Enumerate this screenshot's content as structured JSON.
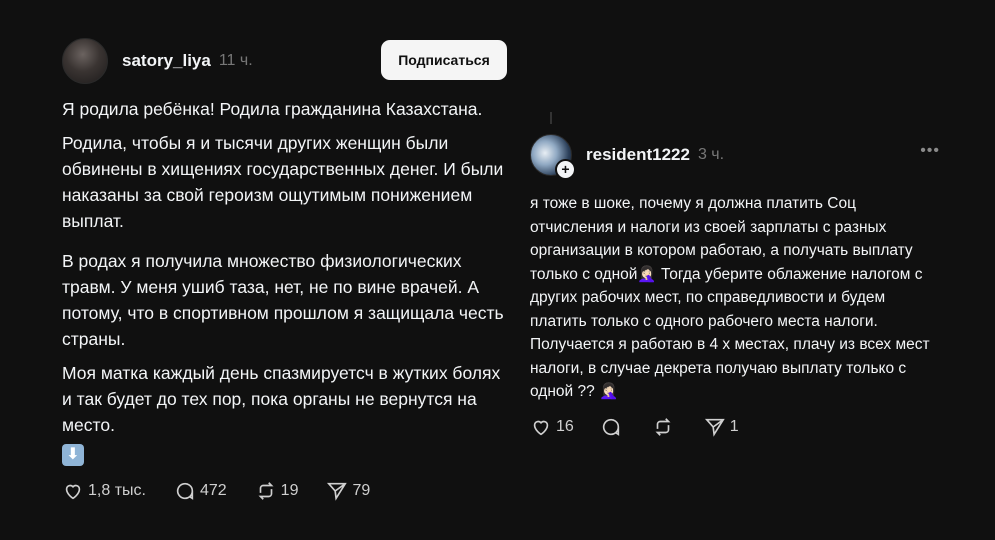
{
  "left_post": {
    "username": "satory_liya",
    "time": "11 ч.",
    "follow_label": "Подписаться",
    "paragraphs": [
      "Я родила ребёнка! Родила гражданина Казахстана.",
      "Родила, чтобы я и тысячи других женщин были обвинены в хищениях государственных денег. И были наказаны за свой героизм ощутимым понижением выплат.",
      "В родах я получила множество физиологических травм. У меня ушиб таза, нет, не по вине врачей. А потому, что в спортивном прошлом я защищала честь страны.",
      "Моя матка каждый день спазмируетсч в жутких болях и так будет до тех пор, пока органы не вернутся на место."
    ],
    "emoji": "⬇",
    "likes": "1,8 тыс.",
    "comments": "472",
    "reposts": "19",
    "shares": "79"
  },
  "right_post": {
    "username": "resident1222",
    "time": "3 ч.",
    "more": "•••",
    "text": "я тоже в шоке, почему я должна платить Соц отчисления и налоги из своей зарплаты с разных организации в котором работаю, а получать выплату только с одной🤦🏻‍♀️ Тогда уберите облажение налогом с других рабочих мест, по справедливости и будем платить только с одного рабочего места налоги. Получается я работаю в 4 х местах, плачу из всех мест налоги, в случае декрета получаю выплату только с одной ?? 🤦🏻‍♀️",
    "likes": "16",
    "shares": "1"
  }
}
